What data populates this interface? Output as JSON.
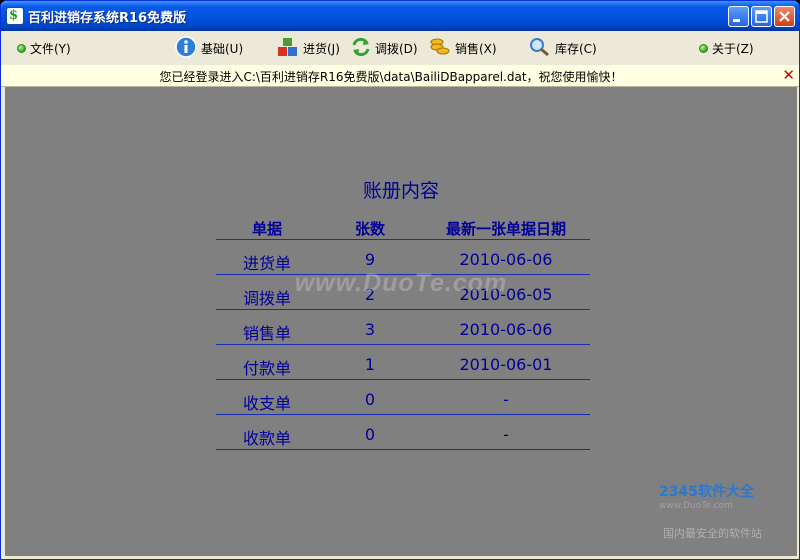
{
  "window": {
    "title": "百利进销存系统R16免费版"
  },
  "menu": [
    {
      "label": "文件(Y)",
      "icon": "green-dot-icon"
    },
    {
      "label": "基础(U)",
      "icon": "info-icon"
    },
    {
      "label": "进货(J)",
      "icon": "boxes-icon"
    },
    {
      "label": "调拨(D)",
      "icon": "refresh-icon"
    },
    {
      "label": "销售(X)",
      "icon": "coins-icon"
    },
    {
      "label": "库存(C)",
      "icon": "magnifier-icon"
    },
    {
      "label": "关于(Z)",
      "icon": "green-dot-icon"
    }
  ],
  "infobar": {
    "message": "您已经登录进入C:\\百利进销存R16免费版\\data\\BailiDBapparel.dat，祝您使用愉快！",
    "close_symbol": "✕"
  },
  "ledger": {
    "title": "账册内容",
    "headers": [
      "单据",
      "张数",
      "最新一张单据日期"
    ],
    "rows": [
      {
        "name": "进货单",
        "count": "9",
        "date": "2010-06-06"
      },
      {
        "name": "调拨单",
        "count": "2",
        "date": "2010-06-05"
      },
      {
        "name": "销售单",
        "count": "3",
        "date": "2010-06-06"
      },
      {
        "name": "付款单",
        "count": "1",
        "date": "2010-06-01"
      },
      {
        "name": "收支单",
        "count": "0",
        "date": "-"
      },
      {
        "name": "收款单",
        "count": "0",
        "date": "-"
      }
    ]
  },
  "watermark": {
    "text": "www.DuoTe.com",
    "site_name": "2345软件大全",
    "site_url": "www.DuoTe.com",
    "slogan": "国内最安全的软件站"
  },
  "colors": {
    "title_bar": "#0052e0",
    "content_bg": "#808080",
    "table_text": "#000099",
    "infobar_bg": "#ffffe1"
  }
}
